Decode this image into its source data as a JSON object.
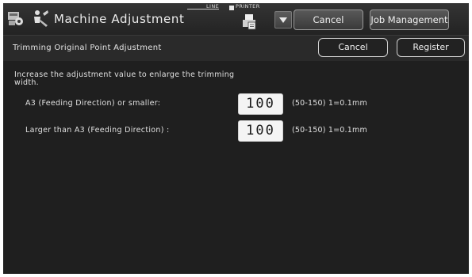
{
  "header": {
    "title": "Machine Adjustment",
    "line_label": "LINE",
    "printer_label": "PRINTER",
    "app_icon": "settings-copier-icon",
    "tool_icon": "wrench-person-icon",
    "printer_icon": "printer-queue-icon",
    "cancel_label": "Cancel",
    "job_management_label": "Job Management"
  },
  "subheader": {
    "title": "Trimming Original Point Adjustment",
    "cancel_label": "Cancel",
    "register_label": "Register"
  },
  "main": {
    "instruction": "Increase the adjustment value to enlarge the trimming width.",
    "settings": [
      {
        "label": "A3 (Feeding Direction) or smaller:",
        "value": "100",
        "range": "(50-150) 1=0.1mm"
      },
      {
        "label": "Larger than A3 (Feeding Direction) :",
        "value": "100",
        "range": "(50-150) 1=0.1mm"
      }
    ]
  },
  "colors": {
    "background": "#1f1f1f",
    "header": "#2c2c2c",
    "value_box": "#f4f4f4",
    "text": "#e0e0e0"
  }
}
